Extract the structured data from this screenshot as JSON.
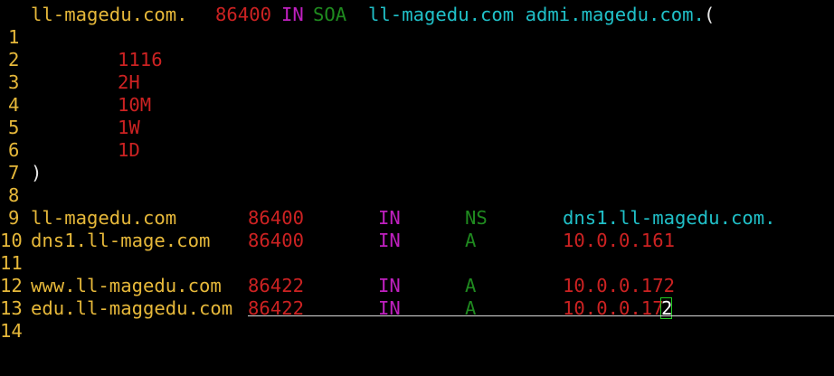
{
  "editor": {
    "lines": [
      {
        "num": "1",
        "tokens": [
          "ll-magedu.com.",
          "86400",
          "IN",
          "SOA",
          "ll-magedu.com admi.magedu.com.",
          "("
        ]
      },
      {
        "num": "2",
        "tokens": []
      },
      {
        "num": "3",
        "tokens": [
          "1116"
        ]
      },
      {
        "num": "4",
        "tokens": [
          "2H"
        ]
      },
      {
        "num": "5",
        "tokens": [
          "10M"
        ]
      },
      {
        "num": "6",
        "tokens": [
          "1W"
        ]
      },
      {
        "num": "7",
        "tokens": [
          "1D"
        ]
      },
      {
        "num": "8",
        "tokens": [
          ")"
        ]
      },
      {
        "num": "9",
        "tokens": []
      },
      {
        "num": "10",
        "tokens": [
          "ll-magedu.com",
          "86400",
          "IN",
          "NS",
          "dns1.ll-magedu.com."
        ]
      },
      {
        "num": "11",
        "tokens": [
          "dns1.ll-mage.com",
          "86400",
          "IN",
          "A",
          "10.0.0.161"
        ]
      },
      {
        "num": "12",
        "tokens": []
      },
      {
        "num": "13",
        "tokens": [
          "www.ll-magedu.com",
          "86422",
          "IN",
          "A",
          "10.0.0.172"
        ]
      },
      {
        "num": "14",
        "tokens": [
          "edu.ll-maggedu.com",
          "86422",
          "IN",
          "A",
          "10.0.0.17",
          "2"
        ]
      }
    ]
  },
  "colors": {
    "background": "#000000",
    "line_number": "#e6b83a",
    "name": "#e6b83a",
    "ttl": "#cc2222",
    "class": "#c020c0",
    "type": "#1f8a1f",
    "target": "#20c0c8",
    "address": "#cc2222",
    "cursor_border": "#22cc22"
  }
}
